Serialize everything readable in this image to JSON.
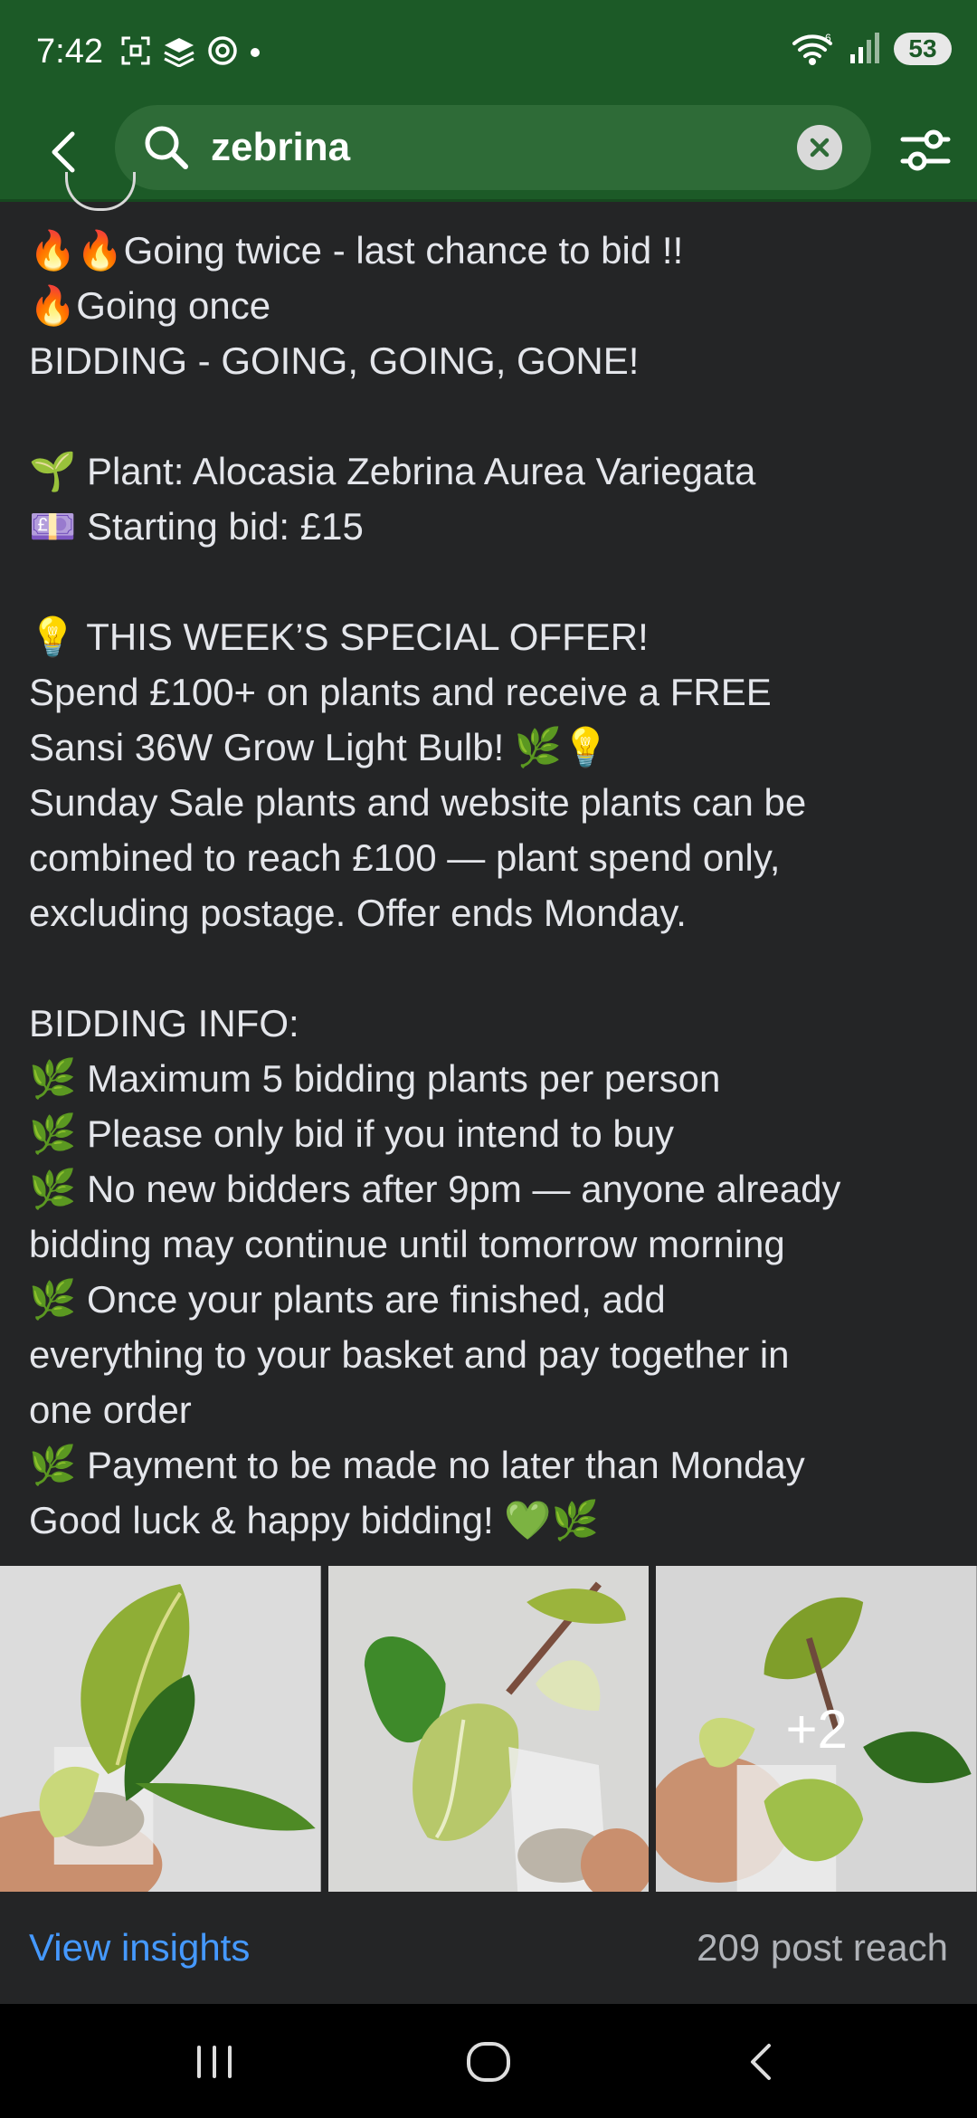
{
  "status_bar": {
    "time": "7:42",
    "battery": "53"
  },
  "search": {
    "query": "zebrina"
  },
  "post": {
    "lines": [
      {
        "emoji": "🔥🔥",
        "text": "Going twice - last chance to bid !!"
      },
      {
        "emoji": "🔥",
        "text": "Going once"
      },
      {
        "emoji": "",
        "text": "BIDDING - GOING, GOING, GONE!"
      },
      {
        "emoji": "",
        "text": ""
      },
      {
        "emoji": "🌱",
        "text": " Plant: Alocasia Zebrina Aurea Variegata"
      },
      {
        "emoji": "💷",
        "text": " Starting bid: £15"
      },
      {
        "emoji": "",
        "text": ""
      },
      {
        "emoji": "💡",
        "text": "  THIS WEEK’S SPECIAL OFFER!"
      },
      {
        "emoji": "",
        "text": "Spend £100+ on plants and receive a FREE"
      },
      {
        "emoji": "",
        "text": "Sansi 36W Grow Light Bulb! 🌿💡"
      },
      {
        "emoji": "",
        "text": "Sunday Sale plants and website plants can be"
      },
      {
        "emoji": "",
        "text": "combined to reach £100 — plant spend only,"
      },
      {
        "emoji": "",
        "text": "excluding postage. Offer ends Monday."
      },
      {
        "emoji": "",
        "text": ""
      },
      {
        "emoji": "",
        "text": "BIDDING INFO:"
      },
      {
        "emoji": "🌿",
        "text": " Maximum 5 bidding plants per person"
      },
      {
        "emoji": "🌿",
        "text": " Please only bid if you intend to buy"
      },
      {
        "emoji": "🌿",
        "text": " No new bidders after 9pm — anyone already"
      },
      {
        "emoji": "",
        "text": "bidding may continue until tomorrow morning"
      },
      {
        "emoji": "🌿",
        "text": " Once your plants are finished, add"
      },
      {
        "emoji": "",
        "text": "everything to your basket and pay together in"
      },
      {
        "emoji": "",
        "text": "one order"
      },
      {
        "emoji": "🌿",
        "text": " Payment to be made no later than Monday"
      },
      {
        "emoji": "",
        "text": "Good luck & happy bidding! 💚🌿"
      }
    ],
    "photos_more_count": "+2"
  },
  "insights": {
    "view_label": "View insights",
    "reach_label": "209 post reach"
  },
  "colors": {
    "header_green": "#1c5a27",
    "link_blue": "#4599ff",
    "background": "#242526"
  }
}
